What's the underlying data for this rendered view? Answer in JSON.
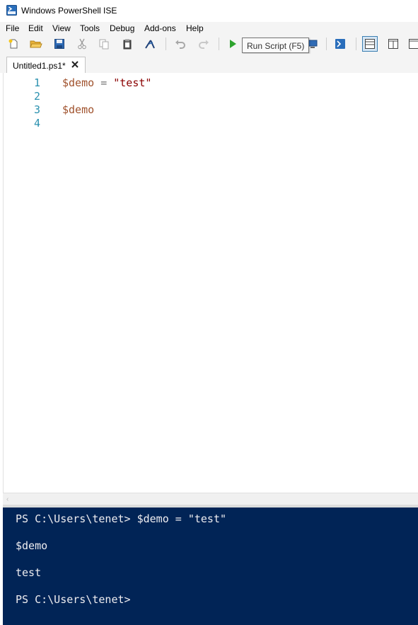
{
  "window": {
    "title": "Windows PowerShell ISE"
  },
  "menu": [
    "File",
    "Edit",
    "View",
    "Tools",
    "Debug",
    "Add-ons",
    "Help"
  ],
  "toolbar": {
    "tooltip": "Run Script (F5)",
    "icons": [
      "new-icon",
      "open-icon",
      "save-icon",
      "cut-icon",
      "copy-icon",
      "paste-icon",
      "clear-console-icon",
      "undo-icon",
      "redo-icon",
      "run-script-icon",
      "remote-powershell-icon",
      "powershell-console-icon",
      "show-script-pane-top-icon",
      "show-script-pane-right-icon",
      "show-script-pane-maximized-icon"
    ]
  },
  "tabs": [
    {
      "label": "Untitled1.ps1*"
    }
  ],
  "editor": {
    "lines": [
      {
        "num": "1",
        "var": "$demo",
        "op": "=",
        "str": "\"test\""
      },
      {
        "num": "2"
      },
      {
        "num": "3",
        "var": "$demo"
      },
      {
        "num": "4"
      }
    ]
  },
  "console": {
    "lines": [
      "PS C:\\Users\\tenet> $demo = \"test\"",
      "$demo",
      "test",
      "PS C:\\Users\\tenet>"
    ]
  },
  "colors": {
    "console_bg": "#012456",
    "console_text": "#eeedf0",
    "line_number": "#2b91af",
    "variable": "#a0522d",
    "string": "#8b0000"
  }
}
